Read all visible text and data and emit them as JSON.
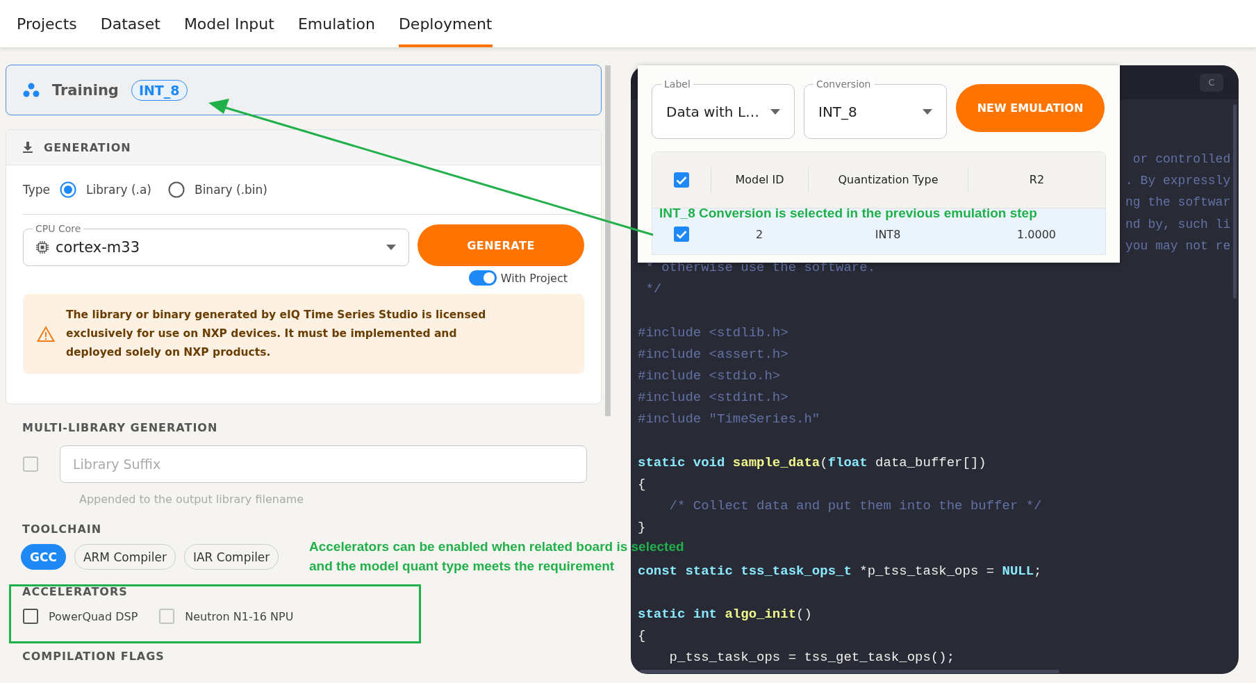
{
  "nav": {
    "tabs": [
      {
        "label": "Projects",
        "selected": false
      },
      {
        "label": "Dataset",
        "selected": false
      },
      {
        "label": "Model Input",
        "selected": false
      },
      {
        "label": "Emulation",
        "selected": false
      },
      {
        "label": "Deployment",
        "selected": true
      }
    ]
  },
  "model": {
    "name": "Training",
    "badge": "INT_8"
  },
  "generation": {
    "title": "GENERATION",
    "type_label": "Type",
    "type_options": [
      {
        "label": "Library (.a)",
        "selected": true
      },
      {
        "label": "Binary (.bin)",
        "selected": false
      }
    ],
    "cpu_core": {
      "label": "CPU Core",
      "value": "cortex-m33"
    },
    "generate_button": "GENERATE",
    "with_project": {
      "label": "With Project",
      "on": true
    },
    "warning": "The library or binary generated by eIQ Time Series Studio is licensed exclusively for use on NXP devices. It must be implemented and deployed solely on NXP products."
  },
  "multi_library": {
    "title": "MULTI-LIBRARY GENERATION",
    "checked": false,
    "suffix_placeholder": "Library Suffix",
    "helper": "Appended to the output library filename"
  },
  "toolchain": {
    "title": "TOOLCHAIN",
    "options": [
      {
        "label": "GCC",
        "selected": true
      },
      {
        "label": "ARM Compiler",
        "selected": false
      },
      {
        "label": "IAR Compiler",
        "selected": false
      }
    ]
  },
  "accelerators": {
    "title": "ACCELERATORS",
    "options": [
      {
        "label": "PowerQuad DSP",
        "checked": false,
        "disabled": false
      },
      {
        "label": "Neutron N1-16 NPU",
        "checked": false,
        "disabled": true
      }
    ]
  },
  "compilation_flags": {
    "title": "COMPILATION FLAGS"
  },
  "code_panel": {
    "button": "C",
    "lines": [
      {
        "kind": "clipped",
        "tokens": [
          {
            "kind": "comment",
            "text": " or controlled"
          }
        ]
      },
      {
        "kind": "clipped",
        "tokens": [
          {
            "kind": "comment",
            "text": ". By expressly"
          }
        ]
      },
      {
        "kind": "clipped",
        "tokens": [
          {
            "kind": "comment",
            "text": "ng the softwar"
          }
        ]
      },
      {
        "kind": "clipped",
        "tokens": [
          {
            "kind": "comment",
            "text": "nd by, such li"
          }
        ]
      },
      {
        "kind": "clipped",
        "tokens": [
          {
            "kind": "comment",
            "text": "you may not re"
          }
        ]
      },
      {
        "kind": "code",
        "tokens": [
          {
            "kind": "comment",
            "text": " * otherwise use the software."
          }
        ]
      },
      {
        "kind": "code",
        "tokens": [
          {
            "kind": "comment",
            "text": " */"
          }
        ]
      },
      {
        "kind": "blank"
      },
      {
        "kind": "code",
        "tokens": [
          {
            "kind": "comment",
            "text": "#include <stdlib.h>"
          }
        ]
      },
      {
        "kind": "code",
        "tokens": [
          {
            "kind": "comment",
            "text": "#include <assert.h>"
          }
        ]
      },
      {
        "kind": "code",
        "tokens": [
          {
            "kind": "comment",
            "text": "#include <stdio.h>"
          }
        ]
      },
      {
        "kind": "code",
        "tokens": [
          {
            "kind": "comment",
            "text": "#include <stdint.h>"
          }
        ]
      },
      {
        "kind": "code",
        "tokens": [
          {
            "kind": "comment",
            "text": "#include \"TimeSeries.h\""
          }
        ]
      },
      {
        "kind": "blank"
      },
      {
        "kind": "code",
        "tokens": [
          {
            "kind": "keyword",
            "text": "static void "
          },
          {
            "kind": "function",
            "text": "sample_data"
          },
          {
            "kind": "plain",
            "text": "("
          },
          {
            "kind": "keyword",
            "text": "float"
          },
          {
            "kind": "plain",
            "text": " data_buffer[])"
          }
        ]
      },
      {
        "kind": "code",
        "tokens": [
          {
            "kind": "plain",
            "text": "{"
          }
        ]
      },
      {
        "kind": "code",
        "tokens": [
          {
            "kind": "comment",
            "text": "    /* Collect data and put them into the buffer */"
          }
        ]
      },
      {
        "kind": "code",
        "tokens": [
          {
            "kind": "plain",
            "text": "}"
          }
        ]
      },
      {
        "kind": "blank"
      },
      {
        "kind": "code",
        "tokens": [
          {
            "kind": "keyword",
            "text": "const static tss_task_ops_t"
          },
          {
            "kind": "plain",
            "text": " *p_tss_task_ops = "
          },
          {
            "kind": "keyword",
            "text": "NULL"
          },
          {
            "kind": "plain",
            "text": ";"
          }
        ]
      },
      {
        "kind": "blank"
      },
      {
        "kind": "code",
        "tokens": [
          {
            "kind": "keyword",
            "text": "static int "
          },
          {
            "kind": "function",
            "text": "algo_init"
          },
          {
            "kind": "plain",
            "text": "()"
          }
        ]
      },
      {
        "kind": "code",
        "tokens": [
          {
            "kind": "plain",
            "text": "{"
          }
        ]
      },
      {
        "kind": "code",
        "tokens": [
          {
            "kind": "plain",
            "text": "    p_tss_task_ops = tss_get_task_ops();"
          }
        ]
      }
    ]
  },
  "emulation_popup": {
    "label_select": {
      "label": "Label",
      "value": "Data with L…"
    },
    "conversion_select": {
      "label": "Conversion",
      "value": "INT_8"
    },
    "new_button": "NEW EMULATION",
    "table": {
      "all_checked": true,
      "columns": [
        "Model ID",
        "Quantization Type",
        "R2"
      ],
      "rows": [
        {
          "checked": true,
          "selected": true,
          "cells": [
            "2",
            "INT8",
            "1.0000"
          ]
        }
      ]
    }
  },
  "annotations": [
    {
      "kind": "arrow",
      "text": "INT_8 Conversion is selected in the previous emulation step"
    },
    {
      "kind": "box",
      "lines": [
        "Accelerators can be enabled when related board is selected",
        "and the model quant type meets the requirement"
      ]
    }
  ]
}
